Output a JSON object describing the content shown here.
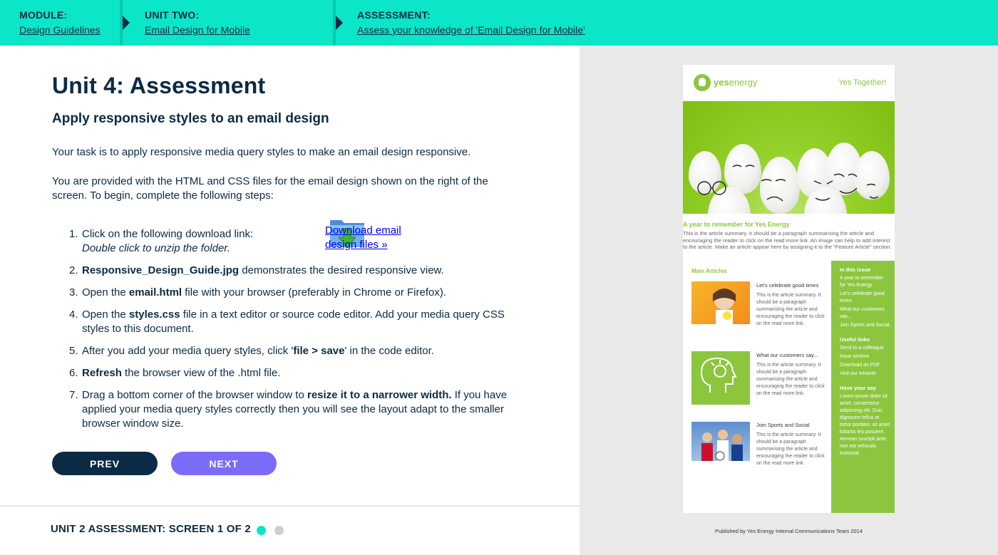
{
  "breadcrumb": {
    "module": {
      "kicker": "MODULE:",
      "link": "Design Guidelines"
    },
    "unit": {
      "kicker": "UNIT TWO:",
      "link": "Email Design for Mobile"
    },
    "assessment": {
      "kicker": "ASSESSMENT:",
      "link": "Assess your knowledge of 'Email Design for Mobile'"
    }
  },
  "main": {
    "title": "Unit 4: Assessment",
    "subtitle": "Apply responsive styles to an email design",
    "intro": "Your task is to apply responsive media query styles to make an email design responsive.",
    "intro2": "You are provided with the HTML and CSS files for the email design shown on the right of the screen. To begin, complete the following steps:",
    "download_link": "Download email design files »",
    "steps": [
      {
        "num": "1.",
        "text": "Click on the following download link:",
        "note": "Double click to unzip the folder."
      },
      {
        "num": "2.",
        "bold": "Responsive_Design_Guide.jpg",
        "text": " demonstrates the desired responsive view."
      },
      {
        "num": "3.",
        "pre": "Open the ",
        "bold": "email.html",
        "text": " file with your browser (preferably in Chrome or Firefox)."
      },
      {
        "num": "4.",
        "pre": "Open the ",
        "bold": "styles.css",
        "text": " file in a text editor or source code editor. Add your media query CSS styles to this document."
      },
      {
        "num": "5.",
        "pre": "After you add your media query styles, click '",
        "bold": "file > save",
        "text": "' in the code editor."
      },
      {
        "num": "6.",
        "bold": "Refresh",
        "text": " the browser view of the .html file."
      },
      {
        "num": "7.",
        "pre": "Drag a bottom corner of the browser window to ",
        "bold": "resize it to a narrower width.",
        "text": " If you have applied your media query styles correctly then you will see the layout adapt to the smaller browser window size."
      }
    ]
  },
  "nav": {
    "prev": "PREV",
    "next": "NEXT"
  },
  "footer": {
    "label": "UNIT 2 ASSESSMENT: SCREEN 1 OF 2",
    "current_screen": 1,
    "total_screens": 2
  },
  "email_preview": {
    "brand_bold": "yes",
    "brand_light": "energy",
    "tagline": "Yes Together!",
    "feature_title": "A year to remember for Yes Energy",
    "feature_summary": "This is the article summary. It should be a paragraph summarising the article and encouraging the reader to click on the read more link. An image can help to add interest to the article. Make an article appear here by assigning it to the \"Feature Article\" section.",
    "main_articles_title": "Main Articles",
    "articles": [
      {
        "title": "Let's celebrate good times",
        "text": "This is the article summary. It should be a paragraph summarising the article and encouraging the reader to click on the read more link."
      },
      {
        "title": "What our customers say...",
        "text": "This is the article summary. It should be a paragraph summarising the article and encouraging the reader to click on the read more link."
      },
      {
        "title": "Join Sports and Social",
        "text": "This is the article summary. It should be a paragraph summarising the article and encouraging the reader to click on the read more link."
      }
    ],
    "sidebar": {
      "in_this_issue_title": "In this issue",
      "in_this_issue": [
        "A year to remember for Yes Energy",
        "Let's celebrate good times",
        "What our customers say...",
        "Join Sports and Social"
      ],
      "useful_links_title": "Useful links",
      "useful_links": [
        "Send to a colleague",
        "Issue archive",
        "Download as PDF",
        "Visit our intranet"
      ],
      "have_your_say_title": "Have your say",
      "have_your_say_text": "Lorem ipsum dolor sit amet, consectetur adipiscing elit. Duis dignissim tellus et tortor porttitor, sit amet lobortis leo posuere. Aenean suscipit ante non est vehicula euismod."
    },
    "footer": "Published by Yes Energy Internal Communications Team 2014"
  },
  "colors": {
    "topbar": "#0ce6c8",
    "navy": "#0b2a45",
    "next_button": "#7a6cf7",
    "brand_green": "#8cc63f",
    "active_dot": "#0ce6c8",
    "inactive_dot": "#cfcfcf"
  }
}
